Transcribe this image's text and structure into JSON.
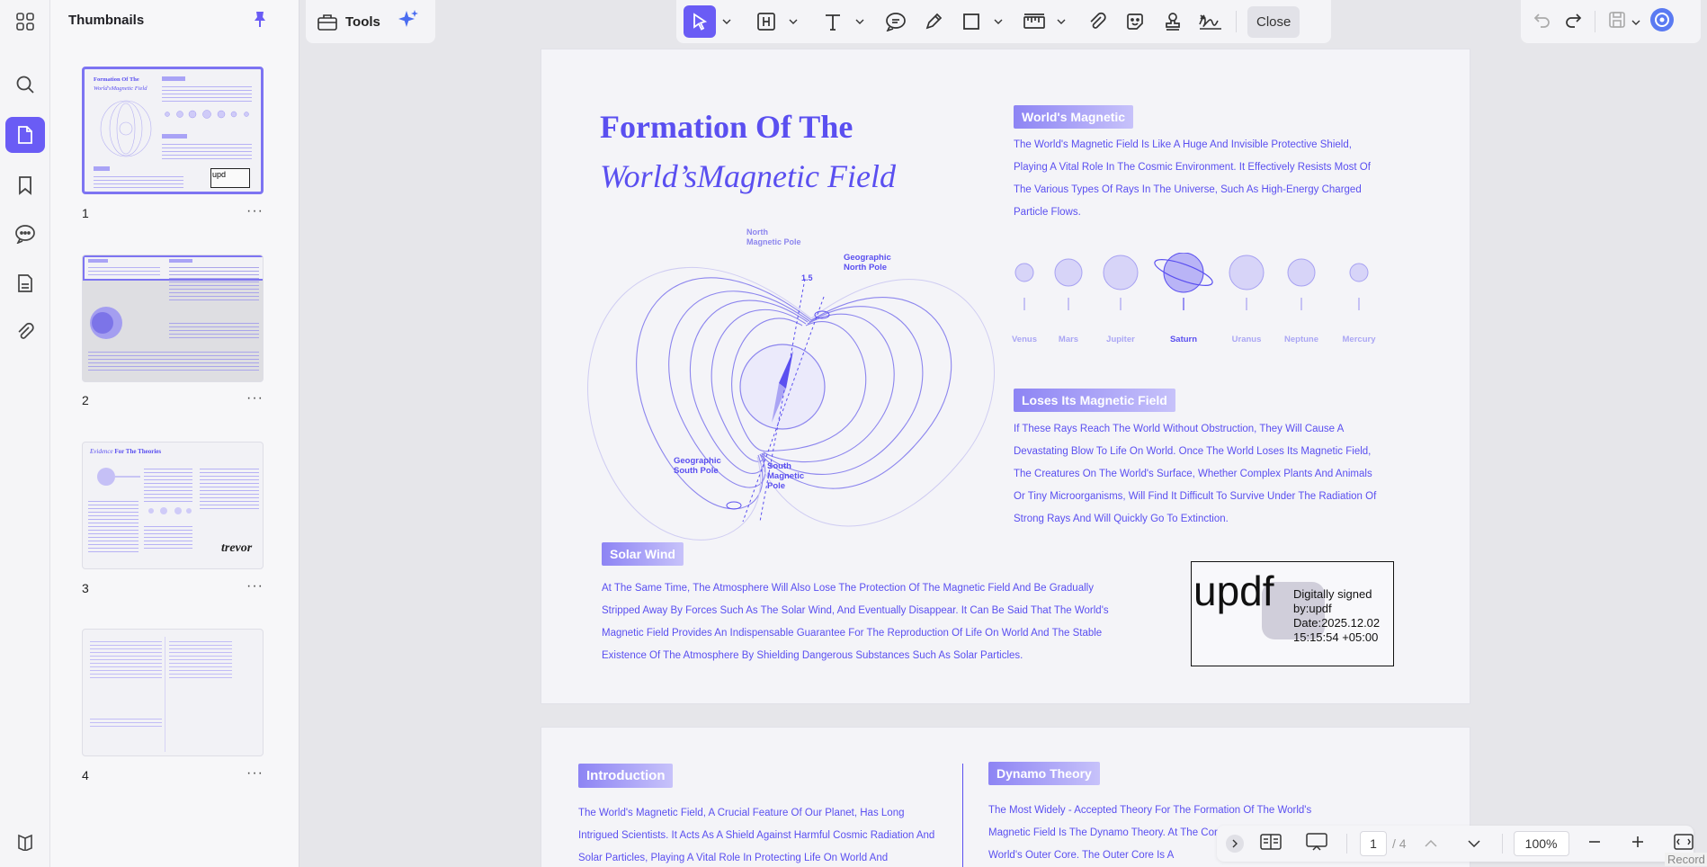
{
  "panel": {
    "title": "Thumbnails"
  },
  "thumbnails": [
    {
      "num": "1",
      "more": "···"
    },
    {
      "num": "2",
      "more": "···"
    },
    {
      "num": "3",
      "more": "···"
    },
    {
      "num": "4",
      "more": "···"
    }
  ],
  "thumb_texts": {
    "t1_title1": "Formation Of The",
    "t1_title2": "World'sMagnetic Field",
    "t3_evidence": "Evidence",
    "t3_rest": "For The Theories",
    "t3_signature": "trevor",
    "t1_stamp": "upd"
  },
  "toolbar": {
    "tools_label": "Tools",
    "close_label": "Close"
  },
  "page1": {
    "title_line1": "Formation Of The",
    "title_line2": "World’sMagnetic Field",
    "diagram": {
      "north_magnetic": "North\nMagnetic Pole",
      "geo_north": "Geographic\nNorth Pole",
      "geo_south": "Geographic\nSouth Pole",
      "south_magnetic": "South\nMagnetic\nPole",
      "angle": "1.5"
    },
    "section1": {
      "heading": "World's Magnetic",
      "body": "The World's Magnetic Field Is Like A Huge And Invisible Protective Shield, Playing A Vital Role In The Cosmic Environment. It Effectively Resists Most Of The Various Types Of Rays In The Universe, Such As High-Energy Charged Particle Flows."
    },
    "planets": [
      "Venus",
      "Mars",
      "Jupiter",
      "Saturn",
      "Uranus",
      "Neptune",
      "Mercury"
    ],
    "section2": {
      "heading": "Loses Its Magnetic Field",
      "body_a": "If These Rays Reach The World Without Obstruction, They Will Cause A Devastating Blow To Life On World. Once The ",
      "body_b": "World Loses Its Magnetic",
      "body_c": " Field, The Creatures On The World's Surface, Whether Complex Plants And Animals Or Tiny Microorganisms, Will Find It Difficult To Survive Under The Radiation Of Strong Rays And Will Quickly Go To Extinction."
    },
    "section3": {
      "heading": "Solar Wind",
      "body_a": "At The Same Time, The Atmosphere Will Also Lose The Protection Of The Magnetic Field And Be Gradually Stripped Away By Forces Such As The Solar Wind, And Eventually Disappear. It Can Be Said That The World's Magnetic Field Provides An Indispensable Guarantee For The Reproduction Of Life On ",
      "body_b": "World And",
      "body_c": " The Stable Existence Of The Atmosphere By Shielding Dangerous Substances Such As Solar Particles."
    },
    "signature": {
      "name": "updf",
      "line1": "Digitally signed",
      "line2": "by:updf",
      "line3": "Date:2025.12.02",
      "line4": "15:15:54 +05:00"
    }
  },
  "page2": {
    "intro_heading": "Introduction",
    "intro_body": "The World's Magnetic Field, A Crucial Feature Of Our Planet, Has Long Intrigued Scientists. It Acts As A Shield Against Harmful Cosmic Radiation And Solar Particles, Playing A Vital Role In Protecting Life On World And",
    "dynamo_heading": "Dynamo Theory",
    "dynamo_body": "The Most Widely - Accepted Theory For The Formation Of The World's Magnetic Field Is The Dynamo Theory. At The Core Of This Theory In The World's Outer Core. The Outer Core Is A"
  },
  "navigation": {
    "current_page": "1",
    "total_pages": "/ 4",
    "zoom": "100%"
  },
  "record_label": "Record",
  "colors": {
    "accent": "#6a5cf5",
    "doc_text": "#5a4ff0"
  }
}
